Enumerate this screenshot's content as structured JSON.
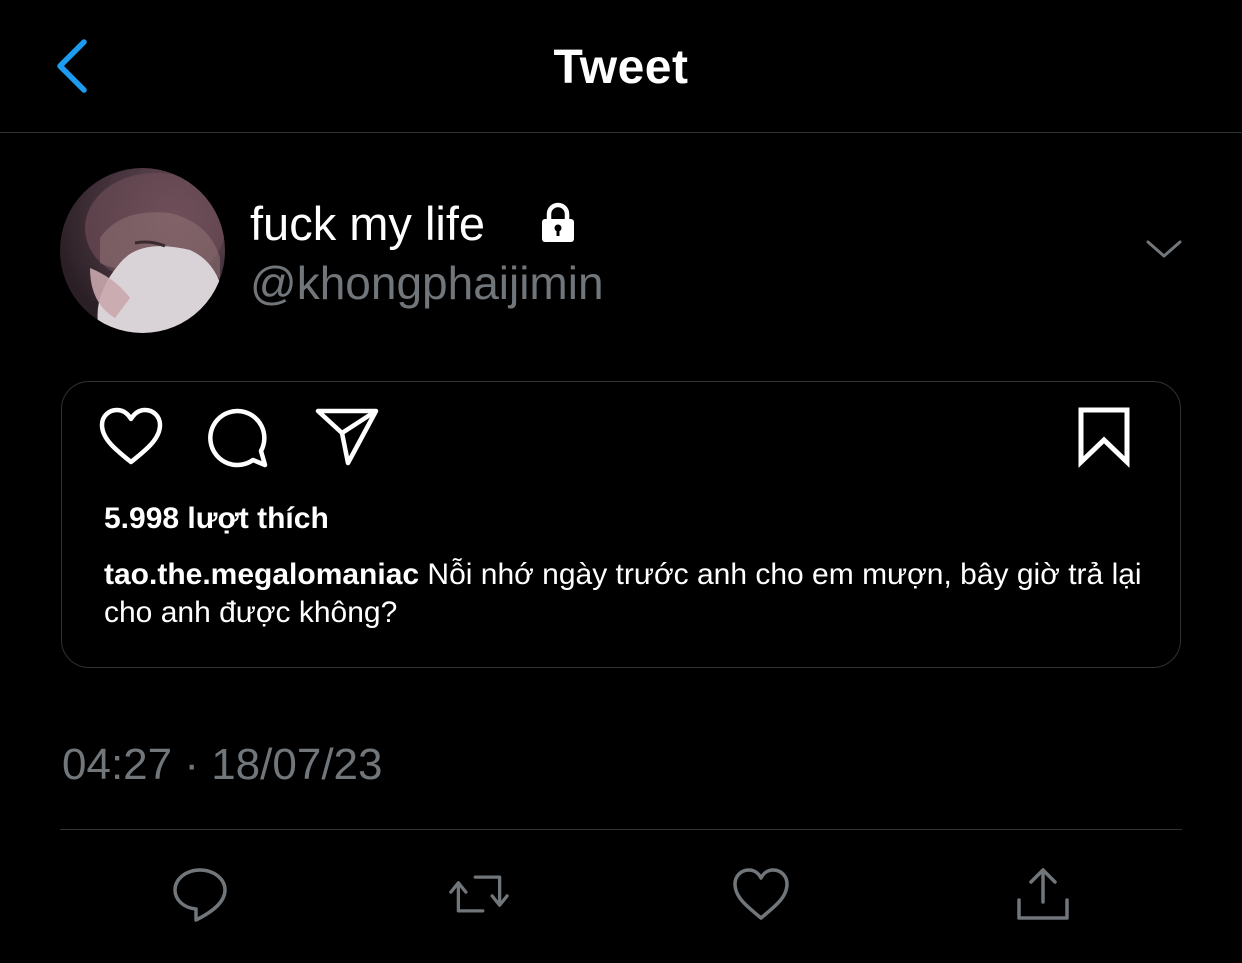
{
  "header": {
    "title": "Tweet",
    "back_icon": "chevron-left-icon"
  },
  "author": {
    "display_name": "fuck my life",
    "handle": "@khongphaijimin",
    "protected_icon": "lock-icon",
    "more_icon": "chevron-down-icon"
  },
  "embedded_post": {
    "icons": [
      "heart-icon",
      "comment-icon",
      "share-send-icon",
      "bookmark-icon"
    ],
    "likes_text": "5.998 lượt thích",
    "caption_user": "tao.the.megalomaniac",
    "caption_text": " Nỗi nhớ ngày trước anh cho em mượn, bây giờ trả lại cho anh được không?"
  },
  "meta": {
    "timestamp": "04:27 · 18/07/23"
  },
  "actions": [
    "reply-icon",
    "retweet-icon",
    "like-icon",
    "share-icon"
  ],
  "colors": {
    "background": "#000000",
    "accent": "#1d9bf0",
    "muted": "#71767b",
    "border": "#2f3336"
  }
}
